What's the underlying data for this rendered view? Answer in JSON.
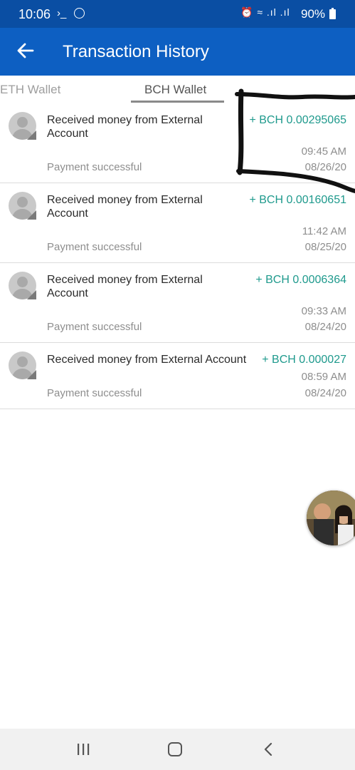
{
  "status_bar": {
    "time": "10:06",
    "terminal_glyph": "›_",
    "icons": "⏰ ≈ .ıl .ıl",
    "battery": "90%"
  },
  "app_bar": {
    "title": "Transaction History",
    "color": "#0d5fc2"
  },
  "tabs": [
    {
      "label": "ETH Wallet",
      "selected": false
    },
    {
      "label": "BCH Wallet",
      "selected": true
    }
  ],
  "transactions": [
    {
      "description_line1": "Received money from External",
      "description_line2": "Account",
      "amount": "+ BCH 0.00295065",
      "time": "09:45 AM",
      "status": "Payment successful",
      "date": "08/26/20"
    },
    {
      "description_line1": "Received money from External",
      "description_line2": "Account",
      "amount": "+ BCH 0.00160651",
      "time": "11:42 AM",
      "status": "Payment successful",
      "date": "08/25/20"
    },
    {
      "description_line1": "Received money from External",
      "description_line2": "Account",
      "amount": "+ BCH 0.0006364",
      "time": "09:33 AM",
      "status": "Payment successful",
      "date": "08/24/20"
    },
    {
      "description_line1": "Received money from External Account",
      "amount": "+ BCH 0.000027",
      "time": "08:59 AM",
      "status": "Payment successful",
      "date": "08/24/20"
    }
  ],
  "colors": {
    "amount": "#1f9a8d",
    "status_bar": "#0a4ea3",
    "scribble": "#111111"
  }
}
